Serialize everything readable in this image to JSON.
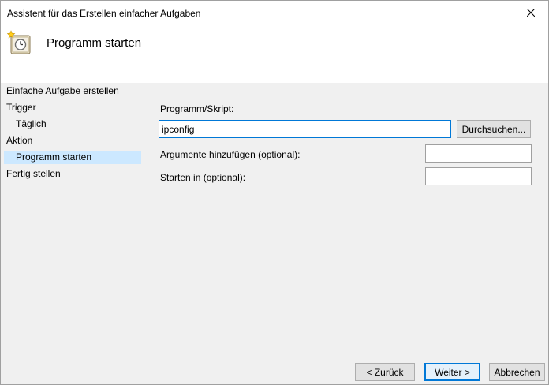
{
  "window": {
    "title": "Assistent für das Erstellen einfacher Aufgaben"
  },
  "header": {
    "title": "Programm starten",
    "icon": "task-clock-icon"
  },
  "sidebar": {
    "steps": [
      {
        "label": "Einfache Aufgabe erstellen",
        "level": 1,
        "active": false
      },
      {
        "label": "Trigger",
        "level": 1,
        "active": false
      },
      {
        "label": "Täglich",
        "level": 2,
        "active": false
      },
      {
        "label": "Aktion",
        "level": 1,
        "active": false
      },
      {
        "label": "Programm starten",
        "level": 2,
        "active": true
      },
      {
        "label": "Fertig stellen",
        "level": 1,
        "active": false
      }
    ]
  },
  "form": {
    "program_label": "Programm/Skript:",
    "program_value": "ipconfig",
    "browse_label": "Durchsuchen...",
    "arguments_label": "Argumente hinzufügen (optional):",
    "arguments_value": "",
    "start_in_label": "Starten in (optional):",
    "start_in_value": ""
  },
  "footer": {
    "back_label": "< Zurück",
    "next_label": "Weiter >",
    "cancel_label": "Abbrechen"
  },
  "colors": {
    "selection": "#cce8ff",
    "focus": "#0078d7"
  }
}
